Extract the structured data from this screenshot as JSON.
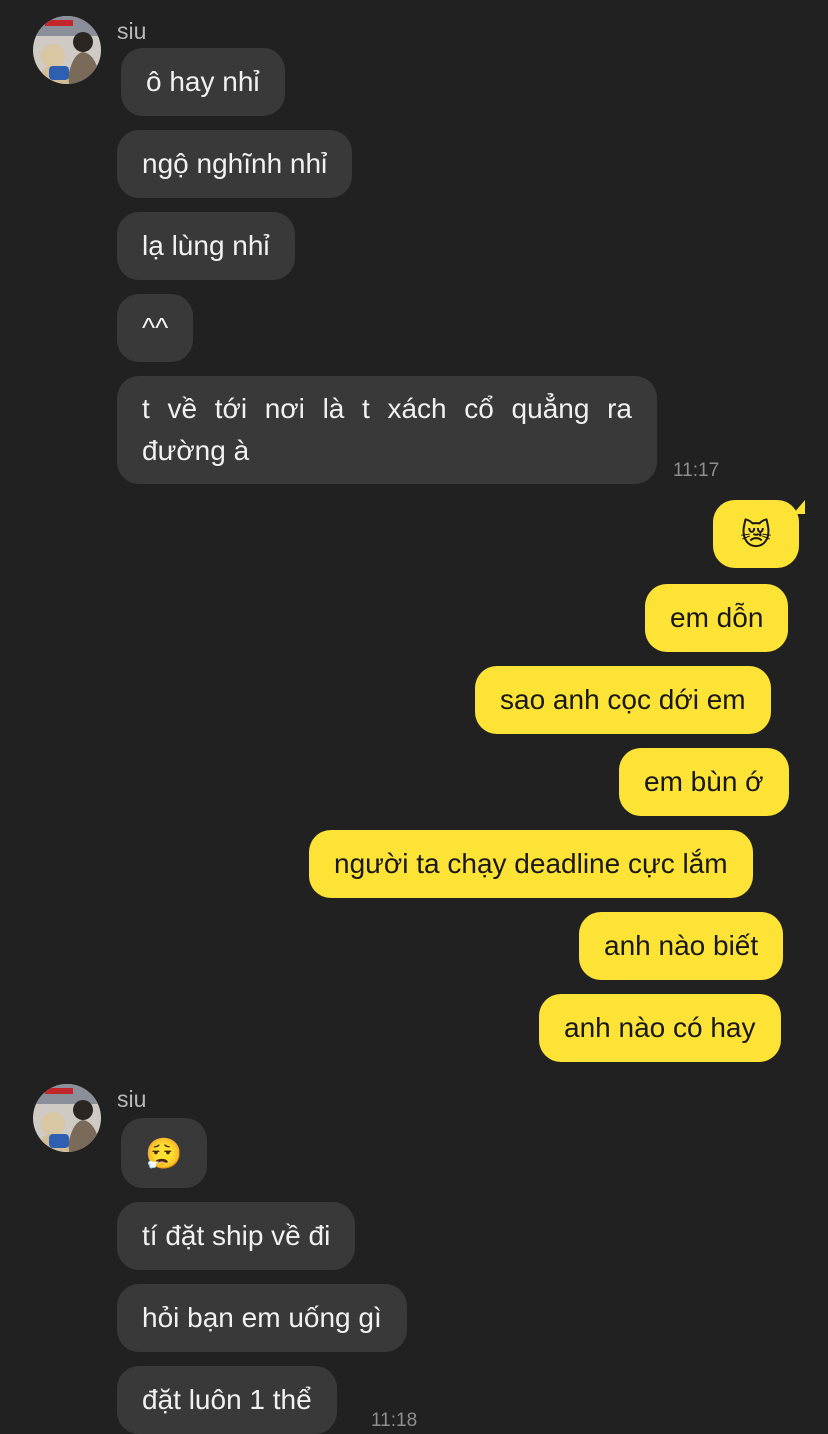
{
  "chat": {
    "groups": [
      {
        "sender": "siu",
        "messages": [
          {
            "text": "ô hay nhỉ"
          },
          {
            "text": "ngộ nghĩnh nhỉ"
          },
          {
            "text": "lạ lùng nhỉ"
          },
          {
            "text": "^^"
          },
          {
            "text": "t về tới nơi là t xách cổ quẳng ra đường à"
          }
        ],
        "time": "11:17"
      },
      {
        "sender": "me",
        "messages": [
          {
            "text": "😿",
            "emoji_name": "crying-cat-face"
          },
          {
            "text": "em dỗn"
          },
          {
            "text": "sao anh cọc dới em"
          },
          {
            "text": "em bùn ớ"
          },
          {
            "text": "người ta chạy deadline cực lắm"
          },
          {
            "text": "anh nào biết"
          },
          {
            "text": "anh nào có hay"
          }
        ]
      },
      {
        "sender": "siu",
        "messages": [
          {
            "text": "😮‍💨",
            "emoji_name": "face-exhaling"
          },
          {
            "text": "tí đặt ship về đi"
          },
          {
            "text": "hỏi bạn em uống gì"
          },
          {
            "text": "đặt luôn 1 thể"
          }
        ],
        "time": "11:18"
      }
    ]
  },
  "colors": {
    "background": "#212121",
    "incoming_bubble": "#393939",
    "outgoing_bubble": "#fce335",
    "incoming_text": "#f1f1f1",
    "outgoing_text": "#181818",
    "meta_text": "#8f8f8f"
  }
}
